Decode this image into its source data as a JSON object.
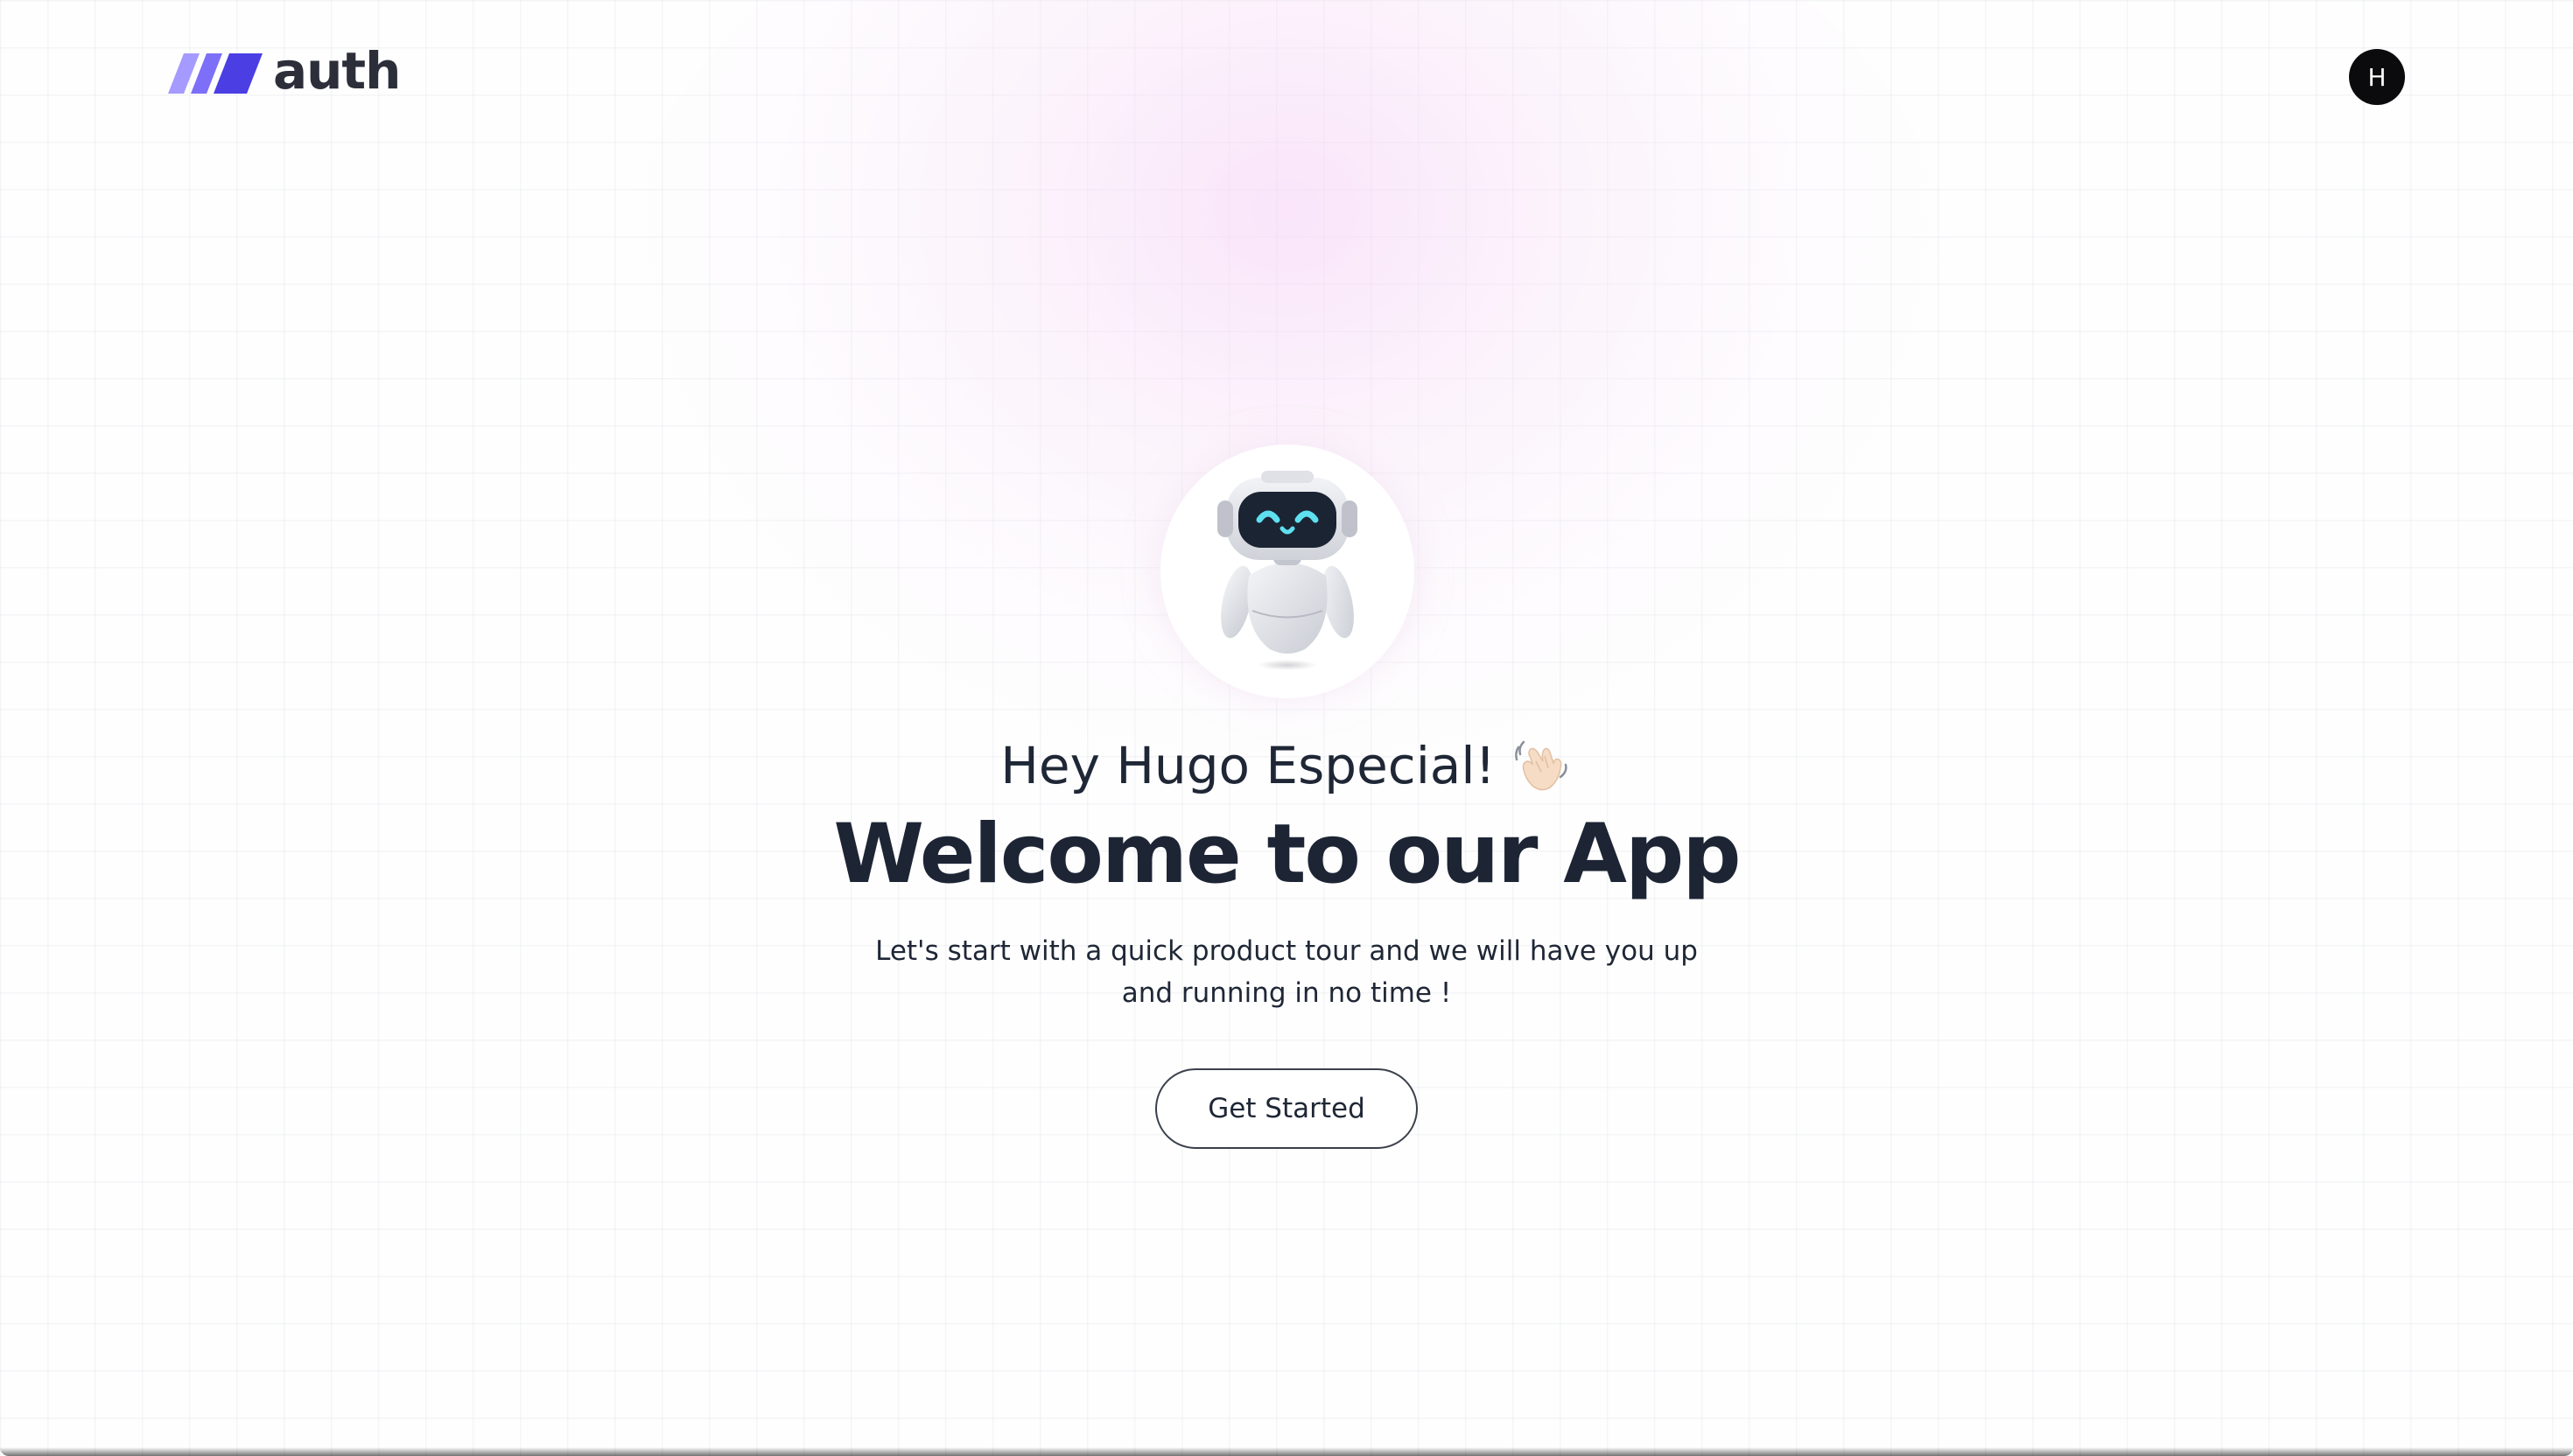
{
  "header": {
    "logo_text": "auth",
    "logo_icon": "triple-slash-logo-icon",
    "avatar_initial": "H"
  },
  "hero": {
    "illustration": "robot-icon",
    "greeting": "Hey Hugo Especial!",
    "greeting_icon": "waving-hand-icon",
    "headline": "Welcome to our App",
    "subtitle": "Let's start with a quick product tour and we will have you up and running in no time !",
    "cta_label": "Get Started"
  },
  "colors": {
    "text": "#1e2638",
    "logo_gradient_start": "#9b8cff",
    "logo_gradient_end": "#4a3fe0",
    "avatar_bg": "#0b0b0d",
    "glow": "#f6d0f6",
    "robot_eyes": "#5ee0f0"
  }
}
